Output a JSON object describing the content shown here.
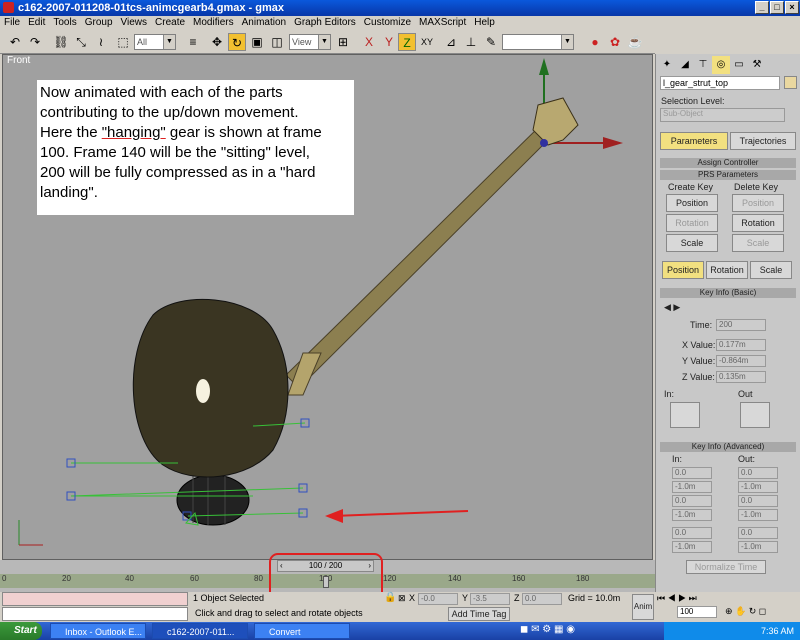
{
  "window": {
    "title": "c162-2007-011208-01tcs-animcgearb4.gmax - gmax",
    "min": "_",
    "max": "□",
    "close": "×"
  },
  "menu": [
    "File",
    "Edit",
    "Tools",
    "Group",
    "Views",
    "Create",
    "Modifiers",
    "Animation",
    "Graph Editors",
    "Customize",
    "MAXScript",
    "Help"
  ],
  "toolbar": {
    "selection_filter": "All",
    "ref_coord": "View"
  },
  "viewport": {
    "label": "Front",
    "note_lines": [
      "Now animated with each of the parts",
      "contributing to the up/down movement.",
      "gear is shown at frame",
      "100.  Frame 140 will be the \"sitting\" level,",
      "200 will be fully compressed as in a \"hard",
      "landing\"."
    ],
    "note_here": "Here the ",
    "note_hanging": "\"hanging\"",
    "colors": {
      "arrow": "#e02020",
      "gear_body": "#3a3522",
      "strut": "#9a8c5a"
    }
  },
  "command_panel": {
    "object_name": "l_gear_strut_top",
    "selection_level": "Selection Level:",
    "sub_object": "Sub-Object",
    "tab_parameters": "Parameters",
    "tab_trajectories": "Trajectories",
    "assign_controller": "Assign Controller",
    "prs_parameters": "PRS Parameters",
    "create_key": "Create Key",
    "delete_key": "Delete Key",
    "btn_position": "Position",
    "btn_rotation": "Rotation",
    "btn_scale": "Scale",
    "key_info_basic": "Key Info (Basic)",
    "time_label": "Time:",
    "time_val": "200",
    "xvalue_label": "X Value:",
    "xvalue": "0.177m",
    "yvalue_label": "Y Value:",
    "yvalue": "-0.864m",
    "zvalue_label": "Z Value:",
    "zvalue": "0.135m",
    "in_label": "In:",
    "out_label": "Out",
    "key_info_adv": "Key Info (Advanced)",
    "adv_in": "In:",
    "adv_out": "Out:",
    "adv_vals": [
      "0.0",
      "-1.0m",
      "0.0",
      "-1.0m"
    ],
    "normalize_time": "Normalize Time"
  },
  "timeline": {
    "slider": "100 / 200",
    "ticks": [
      "0",
      "20",
      "40",
      "60",
      "80",
      "100",
      "120",
      "140",
      "160",
      "180"
    ]
  },
  "status": {
    "selected": "1 Object Selected",
    "prompt": "Click and drag to select and rotate objects",
    "x_val": "-0.0",
    "y_val": "-3.5",
    "z_val": "0.0",
    "grid": "Grid = 10.0m",
    "add_time_tag": "Add Time Tag",
    "anim": "Anim",
    "frame": "100"
  },
  "taskbar": {
    "start": "Start",
    "tasks": [
      "Inbox - Outlook E...",
      "c162-2007-011...",
      "Convert"
    ],
    "clock": "7:36 AM"
  }
}
